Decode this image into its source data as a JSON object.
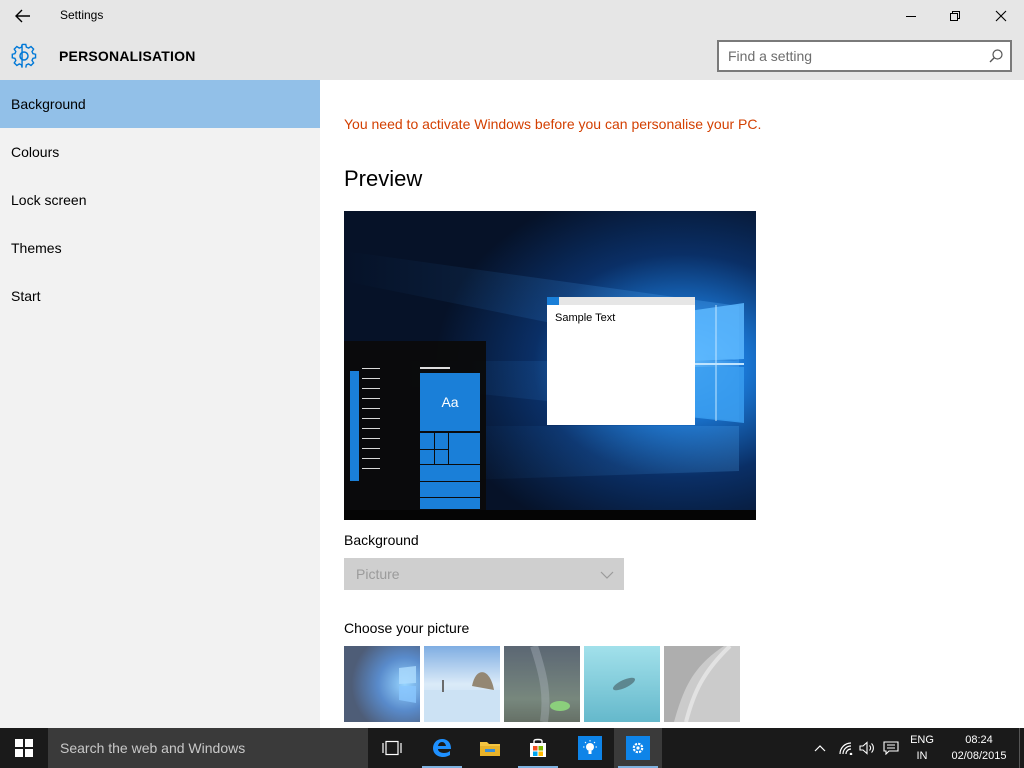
{
  "window": {
    "title": "Settings"
  },
  "header": {
    "section_title": "PERSONALISATION",
    "search_placeholder": "Find a setting"
  },
  "sidebar": {
    "items": [
      {
        "label": "Background",
        "active": true
      },
      {
        "label": "Colours",
        "active": false
      },
      {
        "label": "Lock screen",
        "active": false
      },
      {
        "label": "Themes",
        "active": false
      },
      {
        "label": "Start",
        "active": false
      }
    ]
  },
  "main": {
    "activation_warning": "You need to activate Windows before you can personalise your PC.",
    "preview_heading": "Preview",
    "preview": {
      "sample_text": "Sample Text",
      "tile_text": "Aa"
    },
    "background_label": "Background",
    "background_value": "Picture",
    "choose_picture_label": "Choose your picture"
  },
  "taskbar": {
    "search_text": "Search the web and Windows",
    "lang_line1": "ENG",
    "lang_line2": "IN",
    "time": "08:24",
    "date": "02/08/2015"
  },
  "colors": {
    "accent": "#0078d7",
    "warning": "#d33f00",
    "active_nav": "#92c0e8",
    "taskbar": "#1a1a1a"
  }
}
